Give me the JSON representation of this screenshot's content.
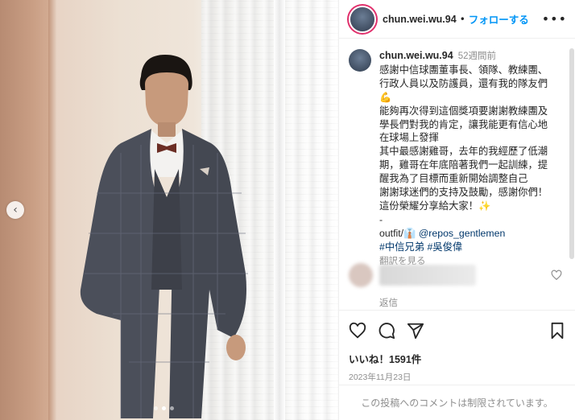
{
  "header": {
    "username": "chun.wei.wu.94",
    "separator": "•",
    "follow_label": "フォローする",
    "more_icon": "more-horizontal-icon"
  },
  "caption": {
    "username": "chun.wei.wu.94",
    "time": "52週間前",
    "lines": [
      "感謝中信球團董事長、領隊、教練團、",
      "行政人員以及防護員，還有我的隊友們",
      "💪",
      "能夠再次得到這個獎項要謝謝教練團及",
      "學長們對我的肯定，讓我能更有信心地",
      "在球場上發揮",
      "其中最感謝雞哥，去年的我經歷了低潮",
      "期，雞哥在年底陪著我們一起訓練，提",
      "醒我為了目標而重新開始調整自己",
      "謝謝球迷們的支持及鼓勵，感謝你們！",
      "這份榮耀分享給大家！✨",
      "-"
    ],
    "outfit_prefix": "outfit/",
    "outfit_emoji": "👔",
    "outfit_mention": "@repos_gentlemen",
    "hashtags": "#中信兄弟 #吳俊偉",
    "translate_label": "翻訳を見る"
  },
  "comment": {
    "reply_label": "返信"
  },
  "actions": {
    "likes": "いいね！1591件",
    "date": "2023年11月23日"
  },
  "footer": {
    "restricted_text": "この投稿へのコメントは制限されています。"
  },
  "carousel": {
    "prev_symbol": "‹",
    "dot_count": 3,
    "active_dot": 1
  },
  "colors": {
    "accent_link": "#0095f6",
    "mention_link": "#00376b",
    "muted": "#8e8e8e"
  }
}
